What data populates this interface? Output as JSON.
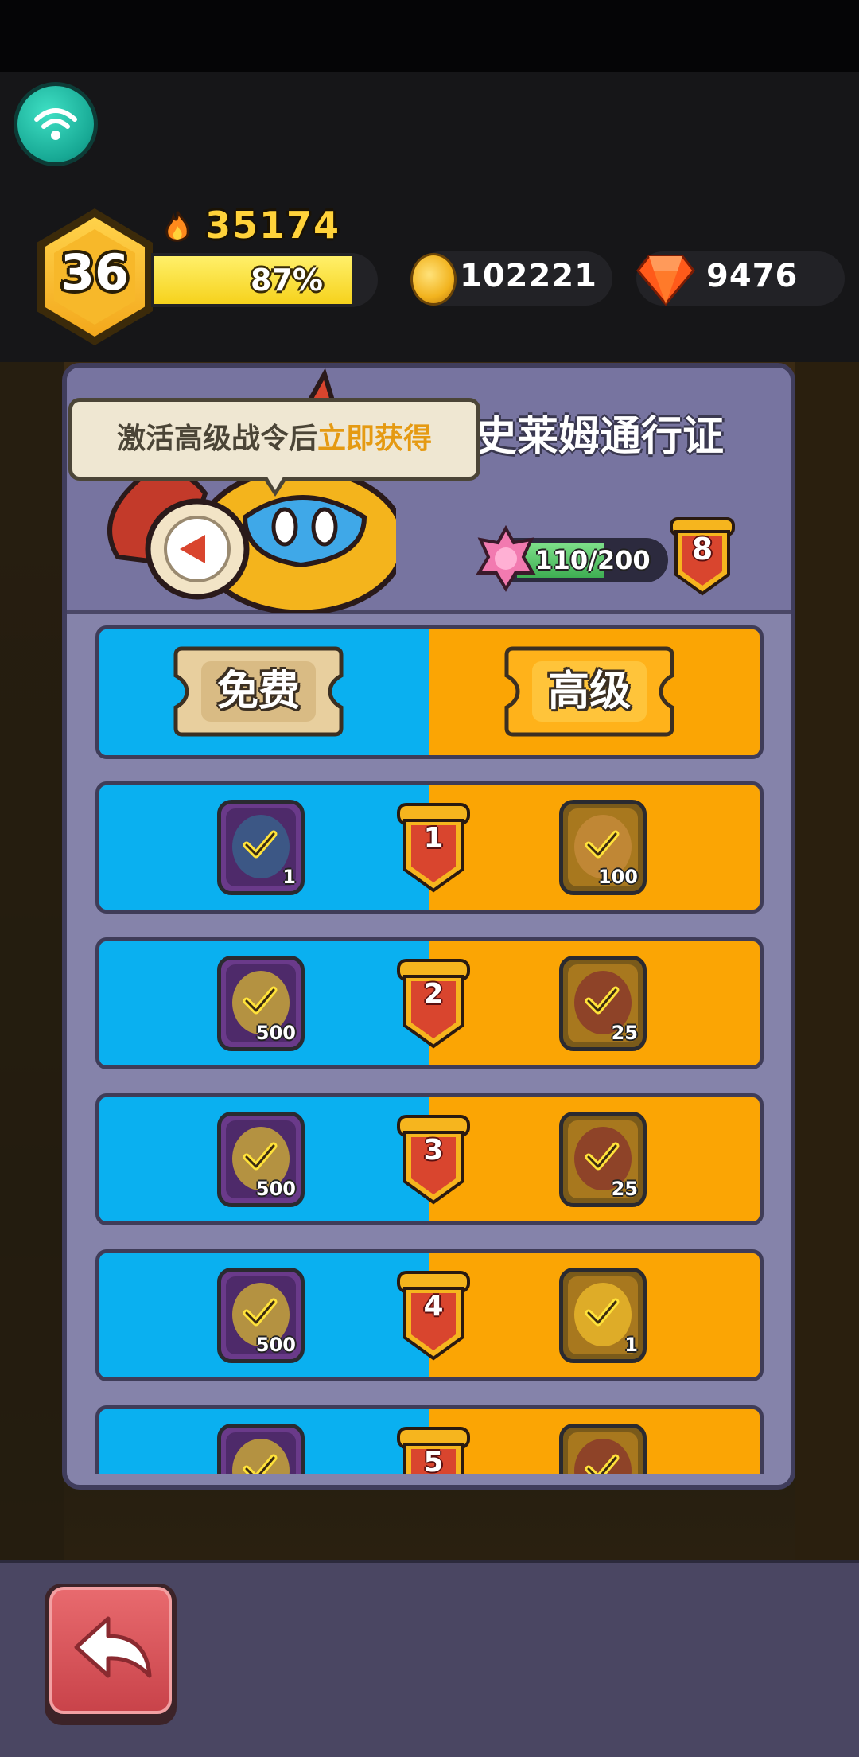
{
  "hud": {
    "player_level": "36",
    "power": "35174",
    "xp_percent": "87%",
    "xp_fraction": 0.87,
    "coins": "102221",
    "gems": "9476"
  },
  "pass": {
    "title": "史莱姆通行证",
    "tooltip_prefix": "激活高级战令后",
    "tooltip_highlight": "立即获得",
    "progress_current": "110",
    "progress_max": "200",
    "progress_fraction": 0.55,
    "pass_level": "8"
  },
  "tabs": {
    "free_label": "免费",
    "premium_label": "高级"
  },
  "rewards": [
    {
      "level": "1",
      "free_qty": "1",
      "free_item": "scroll",
      "premium_qty": "100",
      "premium_item": "cannon",
      "claimed": true
    },
    {
      "level": "2",
      "free_qty": "500",
      "free_item": "coin",
      "premium_qty": "25",
      "premium_item": "book",
      "claimed": true
    },
    {
      "level": "3",
      "free_qty": "500",
      "free_item": "coin",
      "premium_qty": "25",
      "premium_item": "book",
      "claimed": true
    },
    {
      "level": "4",
      "free_qty": "500",
      "free_item": "coin",
      "premium_qty": "1",
      "premium_item": "gold-bar",
      "claimed": true
    },
    {
      "level": "5",
      "free_qty": "",
      "free_item": "coin",
      "premium_qty": "",
      "premium_item": "book",
      "claimed": true
    }
  ],
  "colors": {
    "free_blue": "#0ab0f0",
    "premium_orange": "#fba504",
    "panel": "#8583aa",
    "gold": "#ffd23a"
  },
  "icons": {
    "wifi": "wifi-icon",
    "fire": "fire-icon",
    "coin": "coin-icon",
    "gem": "gem-icon",
    "back": "back-arrow-icon",
    "check": "check-icon"
  }
}
